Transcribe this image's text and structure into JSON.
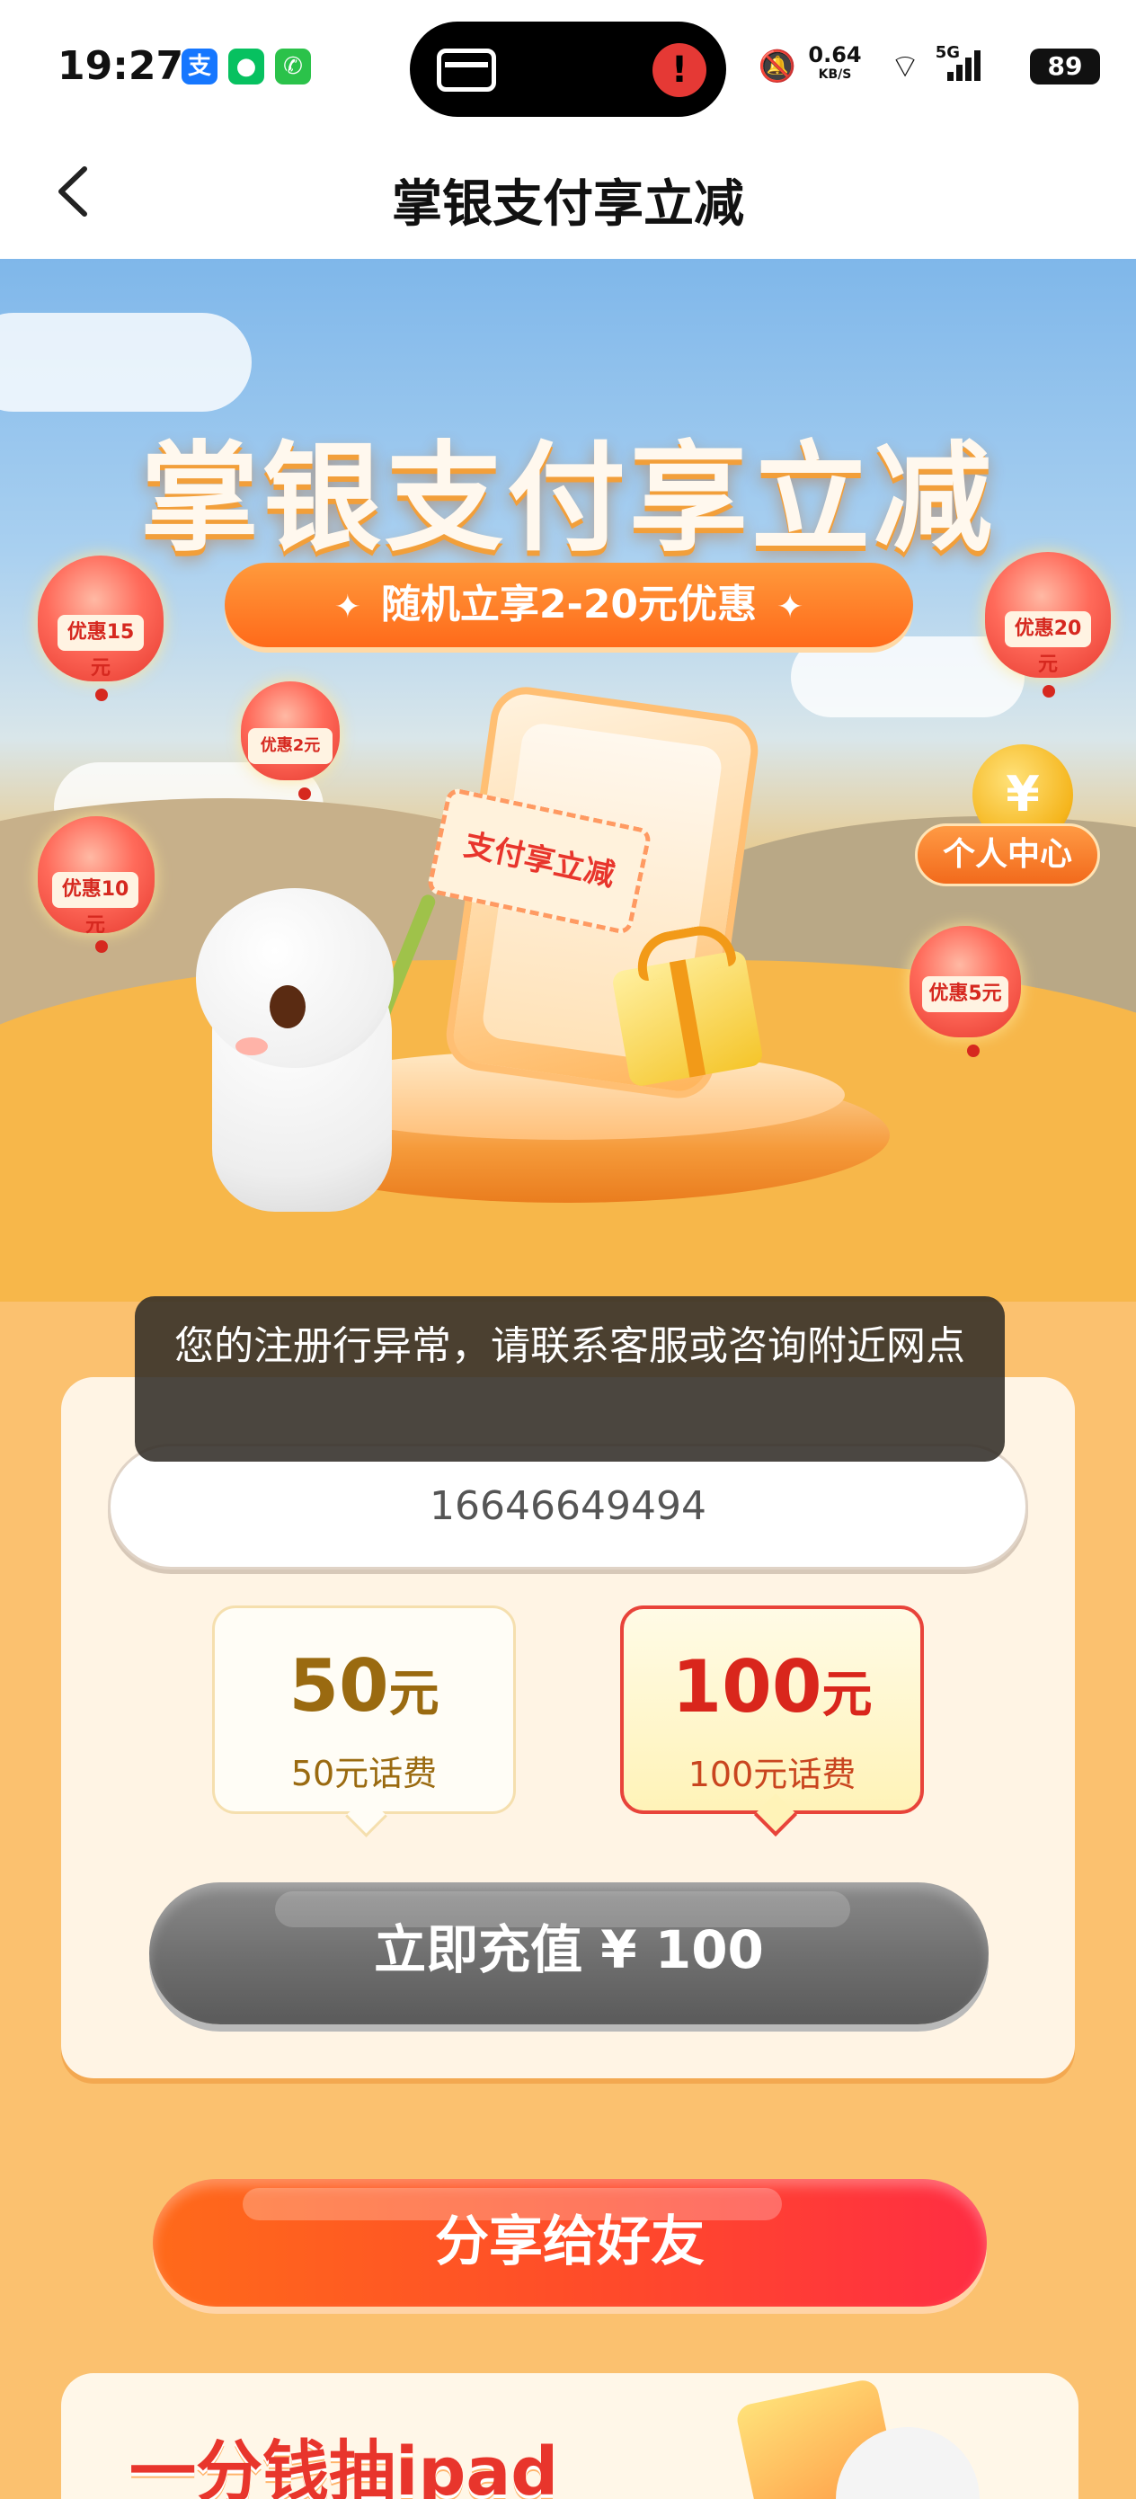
{
  "status_bar": {
    "time": "19:27",
    "app_icons": [
      {
        "name": "alipay-icon",
        "glyph": "支",
        "color": "#1677ff"
      },
      {
        "name": "wechat-icon",
        "glyph": "✆",
        "color": "#07c160"
      },
      {
        "name": "phone-icon",
        "glyph": "✆",
        "color": "#2bc24a"
      }
    ],
    "net_speed": "0.64",
    "net_unit": "KB/S",
    "signal_label": "5G",
    "battery": "89"
  },
  "nav": {
    "back_icon": "chevron-left-icon",
    "title": "掌银支付享立减"
  },
  "banner": {
    "title": "掌银支付享立减",
    "promo": "随机立享2-20元优惠",
    "lanterns": [
      {
        "label": "优惠15元"
      },
      {
        "label": "优惠2元"
      },
      {
        "label": "优惠10元"
      },
      {
        "label": "优惠20元"
      },
      {
        "label": "优惠5元"
      }
    ],
    "coin_symbol": "¥",
    "personal_center": "个人中心",
    "ticket_text": "支付享立减"
  },
  "toast": {
    "message": "您的注册行异常，请联系客服或咨询附近网点"
  },
  "form": {
    "phone_value": "16646649494",
    "options": [
      {
        "value": "50",
        "unit": "元",
        "desc": "50元话费",
        "selected": false
      },
      {
        "value": "100",
        "unit": "元",
        "desc": "100元话费",
        "selected": true
      }
    ],
    "recharge_label": "立即充值 ¥ 100"
  },
  "share_label": "分享给好友",
  "lottery": {
    "title": "一分钱抽ipad"
  }
}
